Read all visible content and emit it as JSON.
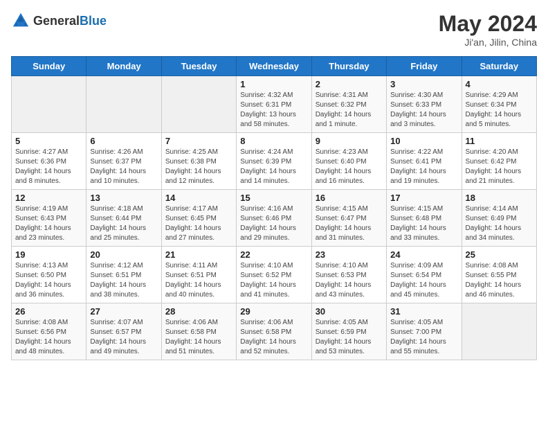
{
  "header": {
    "logo_general": "General",
    "logo_blue": "Blue",
    "month_title": "May 2024",
    "location": "Ji'an, Jilin, China"
  },
  "days_of_week": [
    "Sunday",
    "Monday",
    "Tuesday",
    "Wednesday",
    "Thursday",
    "Friday",
    "Saturday"
  ],
  "weeks": [
    [
      {
        "day": "",
        "info": ""
      },
      {
        "day": "",
        "info": ""
      },
      {
        "day": "",
        "info": ""
      },
      {
        "day": "1",
        "info": "Sunrise: 4:32 AM\nSunset: 6:31 PM\nDaylight: 13 hours and 58 minutes."
      },
      {
        "day": "2",
        "info": "Sunrise: 4:31 AM\nSunset: 6:32 PM\nDaylight: 14 hours and 1 minute."
      },
      {
        "day": "3",
        "info": "Sunrise: 4:30 AM\nSunset: 6:33 PM\nDaylight: 14 hours and 3 minutes."
      },
      {
        "day": "4",
        "info": "Sunrise: 4:29 AM\nSunset: 6:34 PM\nDaylight: 14 hours and 5 minutes."
      }
    ],
    [
      {
        "day": "5",
        "info": "Sunrise: 4:27 AM\nSunset: 6:36 PM\nDaylight: 14 hours and 8 minutes."
      },
      {
        "day": "6",
        "info": "Sunrise: 4:26 AM\nSunset: 6:37 PM\nDaylight: 14 hours and 10 minutes."
      },
      {
        "day": "7",
        "info": "Sunrise: 4:25 AM\nSunset: 6:38 PM\nDaylight: 14 hours and 12 minutes."
      },
      {
        "day": "8",
        "info": "Sunrise: 4:24 AM\nSunset: 6:39 PM\nDaylight: 14 hours and 14 minutes."
      },
      {
        "day": "9",
        "info": "Sunrise: 4:23 AM\nSunset: 6:40 PM\nDaylight: 14 hours and 16 minutes."
      },
      {
        "day": "10",
        "info": "Sunrise: 4:22 AM\nSunset: 6:41 PM\nDaylight: 14 hours and 19 minutes."
      },
      {
        "day": "11",
        "info": "Sunrise: 4:20 AM\nSunset: 6:42 PM\nDaylight: 14 hours and 21 minutes."
      }
    ],
    [
      {
        "day": "12",
        "info": "Sunrise: 4:19 AM\nSunset: 6:43 PM\nDaylight: 14 hours and 23 minutes."
      },
      {
        "day": "13",
        "info": "Sunrise: 4:18 AM\nSunset: 6:44 PM\nDaylight: 14 hours and 25 minutes."
      },
      {
        "day": "14",
        "info": "Sunrise: 4:17 AM\nSunset: 6:45 PM\nDaylight: 14 hours and 27 minutes."
      },
      {
        "day": "15",
        "info": "Sunrise: 4:16 AM\nSunset: 6:46 PM\nDaylight: 14 hours and 29 minutes."
      },
      {
        "day": "16",
        "info": "Sunrise: 4:15 AM\nSunset: 6:47 PM\nDaylight: 14 hours and 31 minutes."
      },
      {
        "day": "17",
        "info": "Sunrise: 4:15 AM\nSunset: 6:48 PM\nDaylight: 14 hours and 33 minutes."
      },
      {
        "day": "18",
        "info": "Sunrise: 4:14 AM\nSunset: 6:49 PM\nDaylight: 14 hours and 34 minutes."
      }
    ],
    [
      {
        "day": "19",
        "info": "Sunrise: 4:13 AM\nSunset: 6:50 PM\nDaylight: 14 hours and 36 minutes."
      },
      {
        "day": "20",
        "info": "Sunrise: 4:12 AM\nSunset: 6:51 PM\nDaylight: 14 hours and 38 minutes."
      },
      {
        "day": "21",
        "info": "Sunrise: 4:11 AM\nSunset: 6:51 PM\nDaylight: 14 hours and 40 minutes."
      },
      {
        "day": "22",
        "info": "Sunrise: 4:10 AM\nSunset: 6:52 PM\nDaylight: 14 hours and 41 minutes."
      },
      {
        "day": "23",
        "info": "Sunrise: 4:10 AM\nSunset: 6:53 PM\nDaylight: 14 hours and 43 minutes."
      },
      {
        "day": "24",
        "info": "Sunrise: 4:09 AM\nSunset: 6:54 PM\nDaylight: 14 hours and 45 minutes."
      },
      {
        "day": "25",
        "info": "Sunrise: 4:08 AM\nSunset: 6:55 PM\nDaylight: 14 hours and 46 minutes."
      }
    ],
    [
      {
        "day": "26",
        "info": "Sunrise: 4:08 AM\nSunset: 6:56 PM\nDaylight: 14 hours and 48 minutes."
      },
      {
        "day": "27",
        "info": "Sunrise: 4:07 AM\nSunset: 6:57 PM\nDaylight: 14 hours and 49 minutes."
      },
      {
        "day": "28",
        "info": "Sunrise: 4:06 AM\nSunset: 6:58 PM\nDaylight: 14 hours and 51 minutes."
      },
      {
        "day": "29",
        "info": "Sunrise: 4:06 AM\nSunset: 6:58 PM\nDaylight: 14 hours and 52 minutes."
      },
      {
        "day": "30",
        "info": "Sunrise: 4:05 AM\nSunset: 6:59 PM\nDaylight: 14 hours and 53 minutes."
      },
      {
        "day": "31",
        "info": "Sunrise: 4:05 AM\nSunset: 7:00 PM\nDaylight: 14 hours and 55 minutes."
      },
      {
        "day": "",
        "info": ""
      }
    ]
  ]
}
